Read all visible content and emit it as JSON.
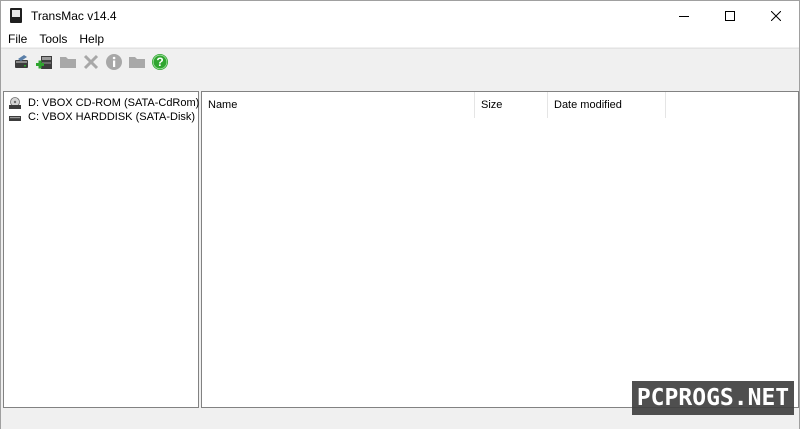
{
  "window": {
    "title": "TransMac v14.4"
  },
  "window_controls": {
    "minimize_icon": "minimize-icon",
    "maximize_icon": "maximize-icon",
    "close_icon": "close-icon"
  },
  "menu": {
    "items": [
      {
        "label": "File"
      },
      {
        "label": "Tools"
      },
      {
        "label": "Help"
      }
    ]
  },
  "toolbar": {
    "buttons": [
      {
        "icon": "open-disk-icon"
      },
      {
        "icon": "new-disk-image-icon"
      },
      {
        "icon": "folder-icon"
      },
      {
        "icon": "delete-icon"
      },
      {
        "icon": "info-icon"
      },
      {
        "icon": "new-folder-icon"
      },
      {
        "icon": "help-icon"
      }
    ]
  },
  "tree": {
    "items": [
      {
        "label": "D: VBOX CD-ROM (SATA-CdRom)",
        "icon": "cdrom-drive-icon"
      },
      {
        "label": "C:  VBOX HARDDISK (SATA-Disk)",
        "icon": "hard-disk-icon"
      }
    ]
  },
  "list": {
    "columns": [
      {
        "label": "Name"
      },
      {
        "label": "Size"
      },
      {
        "label": "Date modified"
      }
    ],
    "rows": []
  },
  "watermark": {
    "text": "PCPROGS.NET"
  },
  "colors": {
    "help_green": "#2fa52f",
    "disabled_gray": "#a8a8a8",
    "pane_border": "#828282"
  }
}
